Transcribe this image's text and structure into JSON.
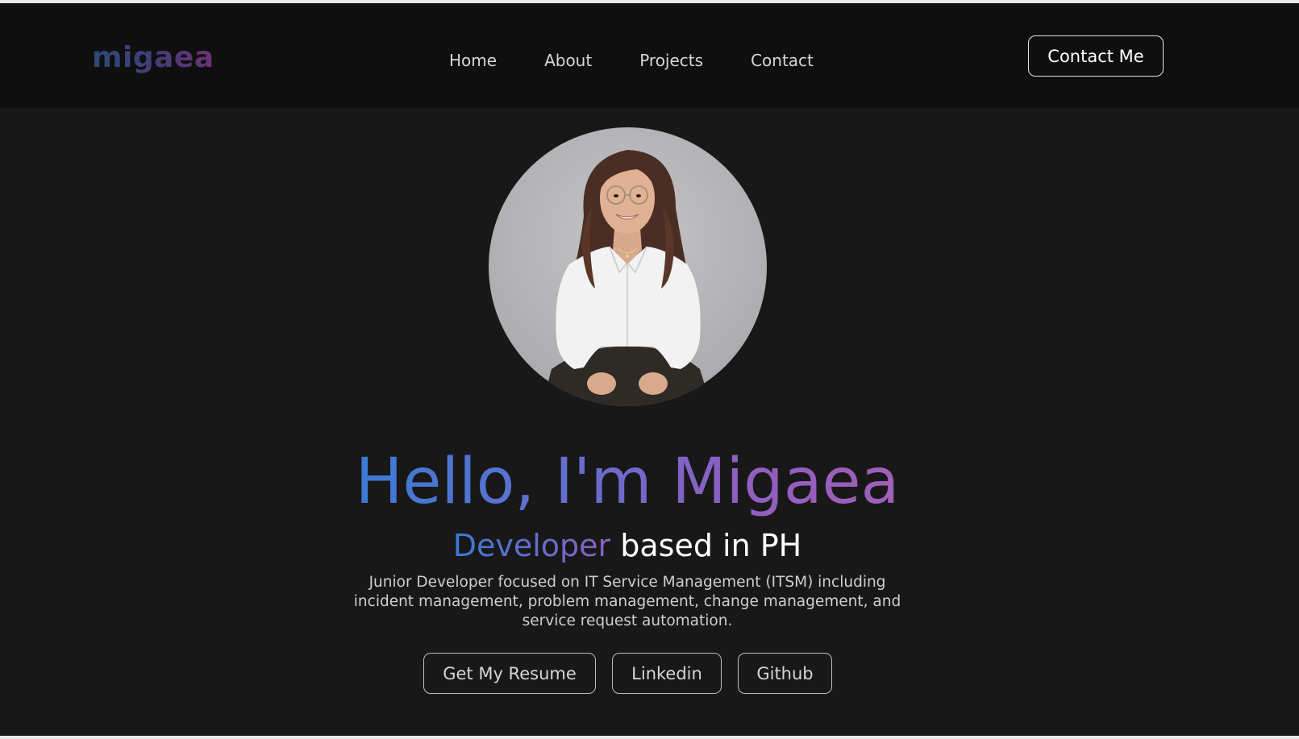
{
  "brand": {
    "logo_text": "migaea"
  },
  "nav": {
    "links": [
      "Home",
      "About",
      "Projects",
      "Contact"
    ],
    "cta_label": "Contact Me"
  },
  "hero": {
    "title": "Hello, I'm Migaea",
    "subtitle_role": "Developer",
    "subtitle_rest": " based in PH",
    "description": "Junior Developer focused on IT Service Management (ITSM) including incident management, problem management, change management, and service request automation.",
    "buttons": {
      "resume": "Get My Resume",
      "linkedin": "Linkedin",
      "github": "Github"
    },
    "profile_image": "profile-photo"
  },
  "colors": {
    "background": "#181818",
    "navbar": "#0f0f0f",
    "gradient_start": "#3a7bd5",
    "gradient_end": "#a15fb8",
    "text_primary": "#ffffff",
    "text_secondary": "#cfcfcf"
  }
}
